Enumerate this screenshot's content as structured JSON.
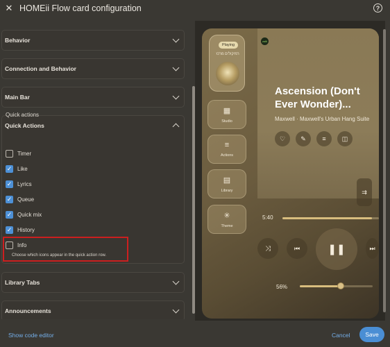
{
  "header": {
    "title": "HOMEii Flow card configuration",
    "close_icon": "close-icon",
    "help_icon": "help-circle-icon",
    "help_glyph": "?"
  },
  "sections": {
    "behavior": "Behavior",
    "connection": "Connection and Behavior",
    "main_bar": "Main Bar",
    "quick_actions": "Quick Actions",
    "library_tabs": "Library Tabs",
    "announcements": "Announcements"
  },
  "quick_actions": {
    "label": "Quick actions",
    "options": [
      {
        "label": "Timer",
        "checked": false
      },
      {
        "label": "Like",
        "checked": true
      },
      {
        "label": "Lyrics",
        "checked": true
      },
      {
        "label": "Queue",
        "checked": true
      },
      {
        "label": "Quick mix",
        "checked": true
      },
      {
        "label": "History",
        "checked": true
      },
      {
        "label": "Info",
        "checked": false
      }
    ],
    "hint": "Choose which icons appear in the quick action row."
  },
  "footer": {
    "show_code": "Show code editor",
    "cancel": "Cancel",
    "save": "Save"
  },
  "preview": {
    "now_playing_badge": "Playing",
    "now_playing_sub": "רמיקולים מרכז",
    "logo_text": "zolii",
    "nav": [
      {
        "label": "Studio",
        "icon": "grid-icon",
        "glyph": "▦"
      },
      {
        "label": "Actions",
        "icon": "menu-icon",
        "glyph": "≡"
      },
      {
        "label": "Library",
        "icon": "library-icon",
        "glyph": "▤"
      },
      {
        "label": "Theme",
        "icon": "sun-icon",
        "glyph": "✳"
      }
    ],
    "song_title": "Ascension (Don't Ever Wonder)...",
    "artist": "Maxwell · Maxwell's Urban Hang Suite",
    "quick_action_icons": [
      {
        "icon": "heart-icon",
        "glyph": "♡"
      },
      {
        "icon": "lyrics-icon",
        "glyph": "✎"
      },
      {
        "icon": "queue-icon",
        "glyph": "≡"
      },
      {
        "icon": "radio-icon",
        "glyph": "◫"
      }
    ],
    "side_icon": "queue-list-icon",
    "side_glyph": "⇉",
    "elapsed": "5:40",
    "progress": 0.93,
    "controls": [
      {
        "icon": "shuffle-icon",
        "glyph": "⤨"
      },
      {
        "icon": "previous-icon",
        "glyph": "⏮"
      },
      {
        "icon": "pause-icon",
        "glyph": "❚❚"
      },
      {
        "icon": "next-icon",
        "glyph": "⏭"
      }
    ],
    "volume": "56%",
    "volume_level": 0.56
  },
  "colors": {
    "accent": "#4a8ed4",
    "highlight_box": "#cc1f1f",
    "checkbox_on": "#4d90d6"
  }
}
